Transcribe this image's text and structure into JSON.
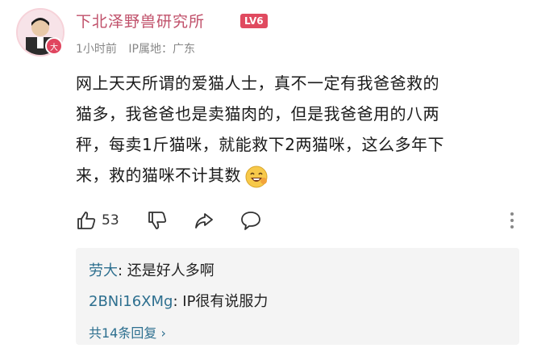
{
  "comment": {
    "username": "下北泽野兽研究所",
    "level": "LV6",
    "time": "1小时前",
    "ip_location": "IP属地：广东",
    "avatar_badge": "大",
    "text_lines": [
      "网上天天所谓的爱猫人士，真不一定有我爸爸救的",
      "猫多，我爸爸也是卖猫肉的，但是我爸爸用的八两",
      "秤，每卖1斤猫咪，就能救下2两猫咪，这么多年下",
      "来，救的猫咪不计其数"
    ],
    "like_count": "53"
  },
  "replies": [
    {
      "name": "劳大",
      "text": ": 还是好人多啊"
    },
    {
      "name": "2BNi16XMg",
      "text": ": IP很有说服力"
    }
  ],
  "reply_more": "共14条回复 ›",
  "colors": {
    "username": "#c0506a",
    "level_badge": "#e04a5f",
    "reply_name": "#2d6f8f"
  },
  "icons": [
    "like-icon",
    "dislike-icon",
    "share-icon",
    "comment-icon",
    "more-vertical-icon",
    "grinning-emoji"
  ]
}
